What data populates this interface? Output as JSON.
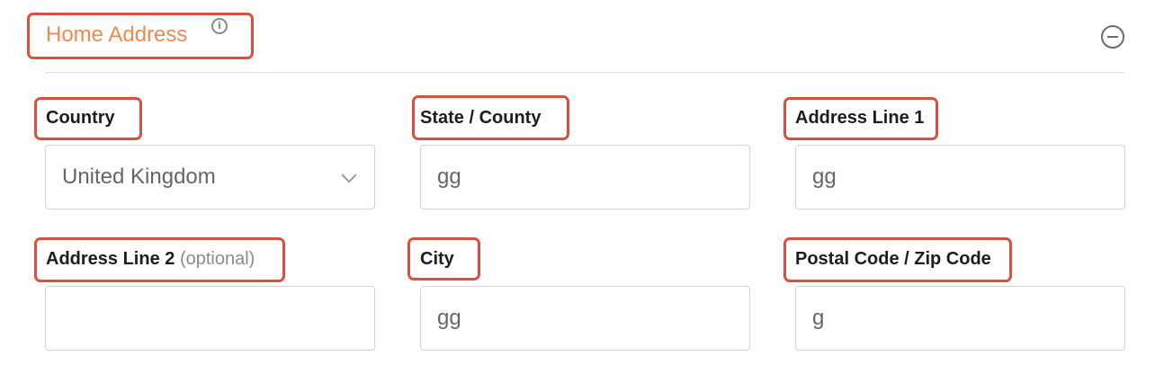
{
  "section": {
    "title": "Home Address",
    "info_icon": "info-icon",
    "collapse_icon": "minus-circle-icon"
  },
  "fields": {
    "country": {
      "label": "Country",
      "value": "United Kingdom",
      "type": "select"
    },
    "state": {
      "label": "State / County",
      "value": "gg"
    },
    "address1": {
      "label": "Address Line 1",
      "value": "gg"
    },
    "address2": {
      "label": "Address Line 2",
      "optional": "(optional)",
      "value": ""
    },
    "city": {
      "label": "City",
      "value": "gg"
    },
    "postal": {
      "label": "Postal Code / Zip Code",
      "value": "g"
    }
  },
  "colors": {
    "title": "#f0894f",
    "highlight": "#d9503f",
    "label": "#1d1d1d",
    "field_border": "#d3d3d3"
  }
}
